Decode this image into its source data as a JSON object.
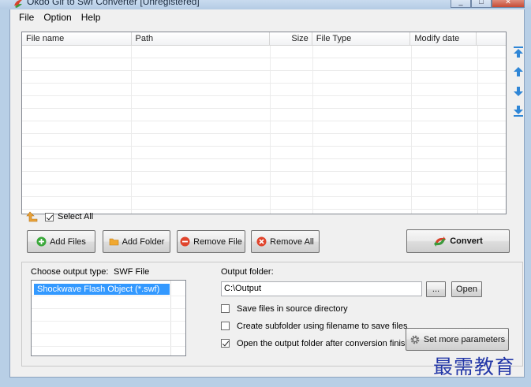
{
  "window": {
    "title": "Okdo Gif to Swf Converter [Unregistered]",
    "controls": [
      "_",
      "□",
      "✕"
    ]
  },
  "menu": [
    "File",
    "Option",
    "Help"
  ],
  "file_list": {
    "columns": [
      "File name",
      "Path",
      "Size",
      "File Type",
      "Modify date"
    ],
    "rows": []
  },
  "select_all": {
    "label": "Select All",
    "checked": true
  },
  "buttons": {
    "add_files": "Add Files",
    "add_folder": "Add Folder",
    "remove_file": "Remove File",
    "remove_all": "Remove All",
    "convert": "Convert",
    "browse": "...",
    "open": "Open",
    "set_more_parameters": "Set more parameters"
  },
  "output_type": {
    "label": "Choose output type:",
    "value": "SWF File",
    "options": [
      "Shockwave Flash Object (*.swf)"
    ]
  },
  "output_folder": {
    "label": "Output folder:",
    "value": "C:\\Output"
  },
  "options": [
    {
      "label": "Save files in source directory",
      "checked": false
    },
    {
      "label": "Create subfolder using filename to save files",
      "checked": false
    },
    {
      "label": "Open the output folder after conversion finished",
      "checked": true
    }
  ],
  "watermark": "最需教育",
  "colors": {
    "selection": "#3399ff",
    "accent_arrows": "#2f86d6",
    "watermark": "#2438a8"
  }
}
